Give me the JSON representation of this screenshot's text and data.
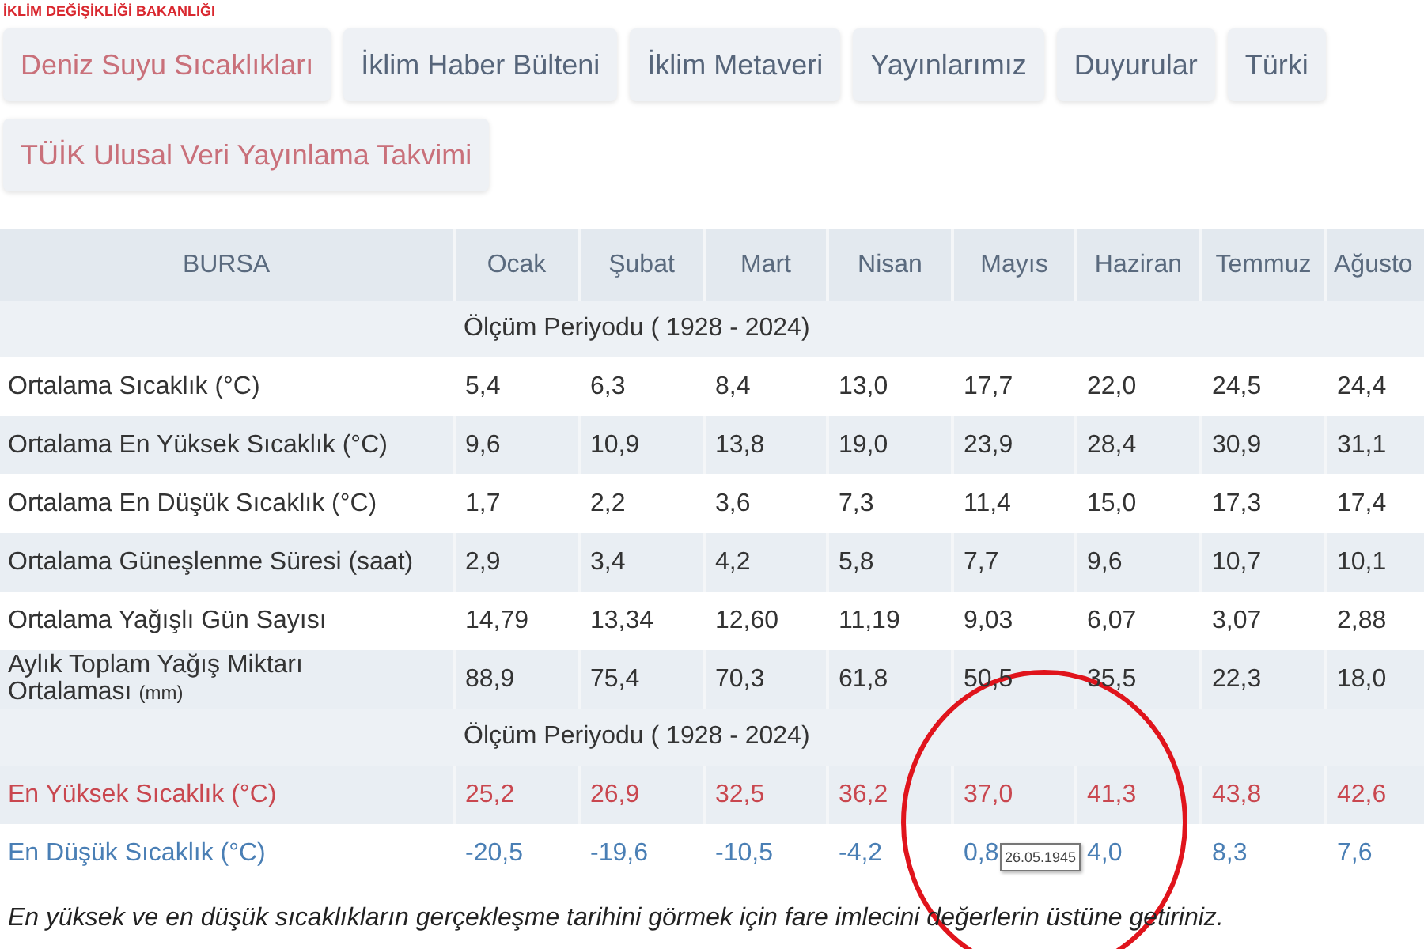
{
  "header": {
    "ministry": "İKLİM DEĞİŞİKLİĞİ BAKANLIĞI"
  },
  "tabs": [
    {
      "label": "Deniz Suyu Sıcaklıkları",
      "kind": "accent"
    },
    {
      "label": "İklim Haber Bülteni",
      "kind": "normal"
    },
    {
      "label": "İklim Metaveri",
      "kind": "normal"
    },
    {
      "label": "Yayınlarımız",
      "kind": "normal"
    },
    {
      "label": "Duyurular",
      "kind": "normal"
    },
    {
      "label": "Türki",
      "kind": "normal"
    },
    {
      "label": "TÜİK Ulusal Veri Yayınlama Takvimi",
      "kind": "accent"
    }
  ],
  "table": {
    "columns": [
      "BURSA",
      "Ocak",
      "Şubat",
      "Mart",
      "Nisan",
      "Mayıs",
      "Haziran",
      "Temmuz",
      "Ağusto"
    ],
    "sections": [
      {
        "period": "Ölçüm Periyodu ( 1928 - 2024)",
        "rows": [
          {
            "label": "Ortalama Sıcaklık (°C)",
            "kind": "normal",
            "values": [
              "5,4",
              "6,3",
              "8,4",
              "13,0",
              "17,7",
              "22,0",
              "24,5",
              "24,4"
            ]
          },
          {
            "label": "Ortalama En Yüksek Sıcaklık (°C)",
            "kind": "normal",
            "values": [
              "9,6",
              "10,9",
              "13,8",
              "19,0",
              "23,9",
              "28,4",
              "30,9",
              "31,1"
            ]
          },
          {
            "label": "Ortalama En Düşük Sıcaklık (°C)",
            "kind": "normal",
            "values": [
              "1,7",
              "2,2",
              "3,6",
              "7,3",
              "11,4",
              "15,0",
              "17,3",
              "17,4"
            ]
          },
          {
            "label": "Ortalama Güneşlenme Süresi (saat)",
            "kind": "normal",
            "values": [
              "2,9",
              "3,4",
              "4,2",
              "5,8",
              "7,7",
              "9,6",
              "10,7",
              "10,1"
            ]
          },
          {
            "label": "Ortalama Yağışlı Gün Sayısı",
            "kind": "normal",
            "values": [
              "14,79",
              "13,34",
              "12,60",
              "11,19",
              "9,03",
              "6,07",
              "3,07",
              "2,88"
            ]
          },
          {
            "label": "Aylık Toplam Yağış Miktarı Ortalaması",
            "unit": "(mm)",
            "kind": "normal",
            "values": [
              "88,9",
              "75,4",
              "70,3",
              "61,8",
              "50,5",
              "35,5",
              "22,3",
              "18,0"
            ]
          }
        ]
      },
      {
        "period": "Ölçüm Periyodu ( 1928 - 2024)",
        "rows": [
          {
            "label": "En Yüksek Sıcaklık (°C)",
            "kind": "high",
            "values": [
              "25,2",
              "26,9",
              "32,5",
              "36,2",
              "37,0",
              "41,3",
              "43,8",
              "42,6"
            ]
          },
          {
            "label": "En Düşük Sıcaklık (°C)",
            "kind": "low",
            "values": [
              "-20,5",
              "-19,6",
              "-10,5",
              "-4,2",
              "0,8",
              "4,0",
              "8,3",
              "7,6"
            ]
          }
        ]
      }
    ]
  },
  "tooltip": {
    "text": "26.05.1945"
  },
  "note": "En yüksek ve en düşük sıcaklıkların gerçekleşme tarihini görmek için fare imlecini değerlerin üstüne getiriniz."
}
